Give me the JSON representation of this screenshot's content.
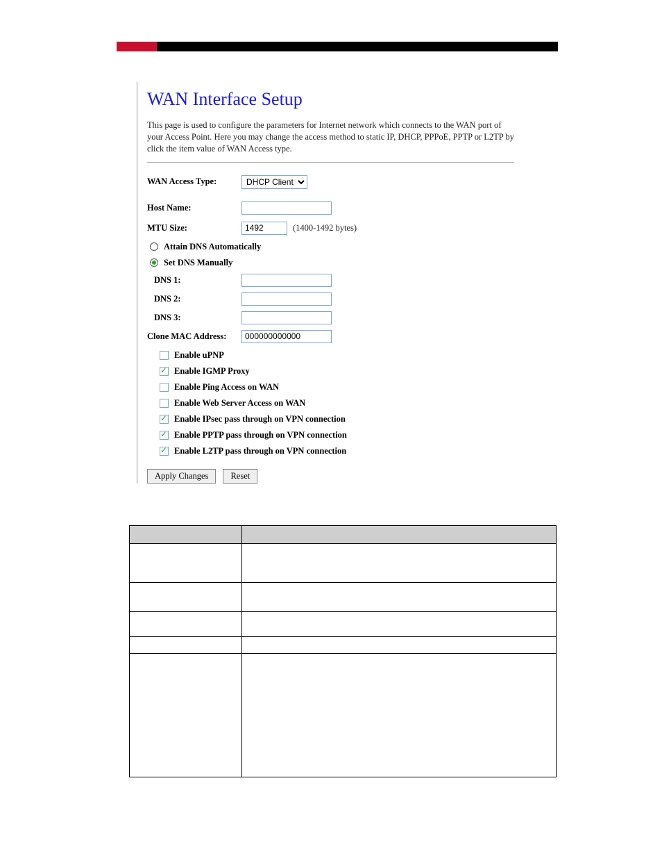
{
  "title": "WAN Interface Setup",
  "description": "This page is used to configure the parameters for Internet network which connects to the WAN port of your Access Point. Here you may change the access method to static IP, DHCP, PPPoE, PPTP or L2TP by click the item value of WAN Access type.",
  "fields": {
    "wan_access_type": {
      "label": "WAN Access Type:",
      "selected": "DHCP Client",
      "options": [
        "DHCP Client"
      ]
    },
    "host_name": {
      "label": "Host Name:",
      "value": ""
    },
    "mtu_size": {
      "label": "MTU Size:",
      "value": "1492",
      "hint": "(1400-1492 bytes)"
    },
    "clone_mac": {
      "label": "Clone MAC Address:",
      "value": "000000000000"
    }
  },
  "dns": {
    "auto_label": "Attain DNS Automatically",
    "manual_label": "Set DNS Manually",
    "mode": "manual",
    "servers": [
      {
        "label": "DNS 1:",
        "value": ""
      },
      {
        "label": "DNS 2:",
        "value": ""
      },
      {
        "label": "DNS 3:",
        "value": ""
      }
    ]
  },
  "options": [
    {
      "key": "upnp",
      "label": "Enable uPNP",
      "checked": false
    },
    {
      "key": "igmp",
      "label": "Enable IGMP Proxy",
      "checked": true
    },
    {
      "key": "ping_wan",
      "label": "Enable Ping Access on WAN",
      "checked": false
    },
    {
      "key": "web_wan",
      "label": "Enable Web Server Access on WAN",
      "checked": false
    },
    {
      "key": "ipsec_pass",
      "label": "Enable IPsec pass through on VPN connection",
      "checked": true
    },
    {
      "key": "pptp_pass",
      "label": "Enable PPTP pass through on VPN connection",
      "checked": true
    },
    {
      "key": "l2tp_pass",
      "label": "Enable L2TP pass through on VPN connection",
      "checked": true
    }
  ],
  "buttons": {
    "apply": "Apply Changes",
    "reset": "Reset"
  },
  "bottom_table": {
    "headers": [
      "",
      ""
    ]
  }
}
